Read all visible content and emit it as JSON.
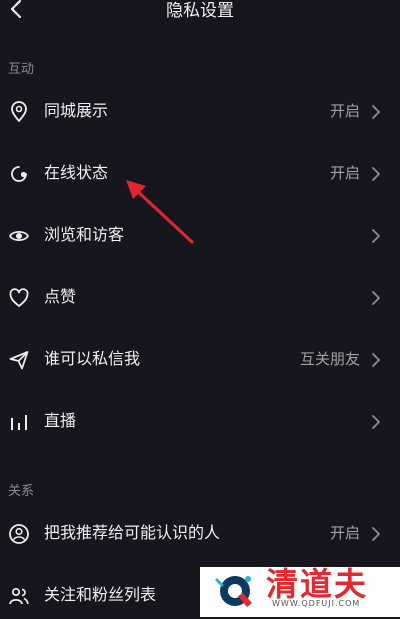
{
  "header": {
    "title": "隐私设置"
  },
  "sections": {
    "interaction": "互动",
    "relation": "关系"
  },
  "rows": [
    {
      "label": "同城展示",
      "value": "开启"
    },
    {
      "label": "在线状态",
      "value": "开启"
    },
    {
      "label": "浏览和访客",
      "value": ""
    },
    {
      "label": "点赞",
      "value": ""
    },
    {
      "label": "谁可以私信我",
      "value": "互关朋友"
    },
    {
      "label": "直播",
      "value": ""
    },
    {
      "label": "把我推荐给可能认识的人",
      "value": "开启"
    },
    {
      "label": "关注和粉丝列表",
      "value": ""
    }
  ],
  "watermark": {
    "brand": "清道夫",
    "url": "WWW.QDFUJI.COM"
  },
  "colors": {
    "background": "#16161e",
    "annotation_arrow": "#e0262b"
  }
}
